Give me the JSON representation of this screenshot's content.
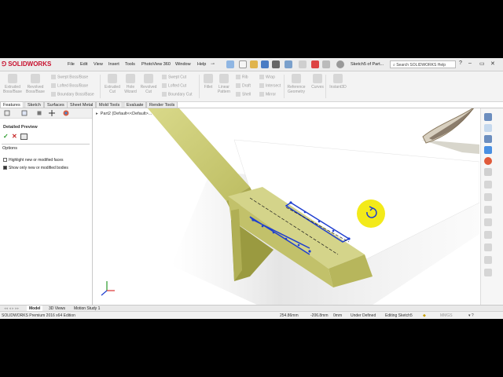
{
  "app": {
    "brand": "SOLIDWORKS",
    "document_title": "Sketch5 of Part...",
    "search_placeholder": "Search SOLIDWORKS Help"
  },
  "menu": [
    "File",
    "Edit",
    "View",
    "Insert",
    "Tools",
    "PhotoView 360",
    "Window",
    "Help"
  ],
  "ribbon": {
    "extruded_boss": "Extruded Boss/Base",
    "revolved_boss": "Revolved Boss/Base",
    "swept_boss": "Swept Boss/Base",
    "lofted_boss": "Lofted Boss/Base",
    "boundary_boss": "Boundary Boss/Base",
    "extruded_cut": "Extruded Cut",
    "hole_wizard": "Hole Wizard",
    "revolved_cut": "Revolved Cut",
    "swept_cut": "Swept Cut",
    "lofted_cut": "Lofted Cut",
    "boundary_cut": "Boundary Cut",
    "fillet": "Fillet",
    "linear_pattern": "Linear Pattern",
    "rib": "Rib",
    "draft": "Draft",
    "shell": "Shell",
    "wrap": "Wrap",
    "intersect": "Intersect",
    "mirror": "Mirror",
    "reference_geometry": "Reference Geometry",
    "curves": "Curves",
    "instant3d": "Instant3D"
  },
  "command_tabs": [
    "Features",
    "Sketch",
    "Surfaces",
    "Sheet Metal",
    "Mold Tools",
    "Evaluate",
    "Render Tools"
  ],
  "property_manager": {
    "title": "Detailed Preview",
    "options_label": "Options",
    "option1": "Highlight new or modified faces",
    "option2": "Show only new or modified bodies",
    "option1_checked": false,
    "option2_checked": true
  },
  "viewport": {
    "tree_label": "Part2  (Default<<Default>..."
  },
  "bottom_tabs": [
    "Model",
    "3D Views",
    "Motion Study 1"
  ],
  "status": {
    "edition": "SOLIDWORKS Premium 2016 x64 Edition",
    "x": "254.86mm",
    "y": "-206.8mm",
    "z": "0mm",
    "state": "Under Defined",
    "editing": "Editing Sketch5",
    "units": "MMGS"
  },
  "colors": {
    "brand_red": "#c8102e",
    "model_yellow": "#c8c86e",
    "sketch_blue": "#1f3fd0",
    "cursor_yellow": "#f3ea1a"
  }
}
